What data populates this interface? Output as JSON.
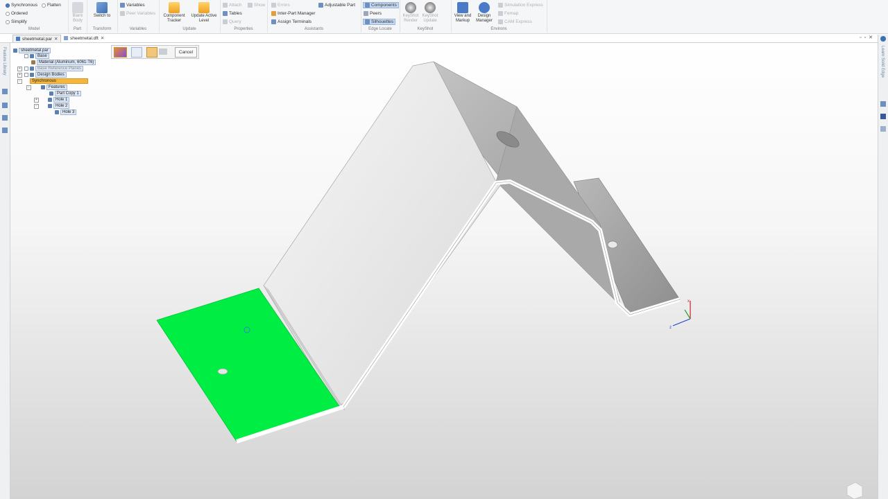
{
  "ribbon": {
    "model": {
      "label": "Model",
      "options": [
        {
          "label": "Synchronous",
          "selected": true
        },
        {
          "label": "Ordered",
          "selected": false
        },
        {
          "label": "Simplify",
          "selected": false
        }
      ],
      "flatten": "Flatten"
    },
    "blank_body": {
      "label": "Blank Body",
      "group": "Part"
    },
    "switch": {
      "label": "Switch to",
      "label2": "Transform"
    },
    "variables": {
      "label": "Variables",
      "peer_vars": "Peer Variables",
      "group": "Variables"
    },
    "update": {
      "component_tracker": "Component Tracker",
      "update_active_level": "Update Active Level",
      "group": "Update"
    },
    "properties": {
      "items": [
        "Attach",
        "Show",
        "Tables",
        "Query"
      ],
      "group": "Properties"
    },
    "assistants": {
      "items": [
        "Errors",
        "Inter-Part Manager",
        "Assign Terminals"
      ],
      "adjustable": "Adjustable Part",
      "group": "Assistants"
    },
    "edge_locate": {
      "items": [
        "Components",
        "Peers",
        "Silhouettes"
      ],
      "group": "Edge Locate"
    },
    "keyshot": {
      "render": "KeyShot Render",
      "update": "KeyShot Update",
      "group": "KeyShot"
    },
    "environs": {
      "view_markup": "View and Markup",
      "design_manager": "Design Manager",
      "items": [
        "Simulation Express",
        "Femap",
        "CAM Express"
      ],
      "group": "Environs"
    }
  },
  "tabs": [
    {
      "label": "sheetmetal.par",
      "active": true
    },
    {
      "label": "sheetmetal.dft",
      "active": false
    }
  ],
  "side": {
    "left": "Feature Library",
    "right": "Learn Solid Edge"
  },
  "tree": {
    "root": "sheetmetal.par",
    "base": "Base",
    "material": "Material (Aluminum, 6061-T6)",
    "ref_planes": "Base Reference Planes",
    "design_bodies": "Design Bodies",
    "synchronous": "Synchronous",
    "features": "Features",
    "items": [
      "Part Copy 1",
      "Hole 1",
      "Hole 2",
      "Hole 3"
    ]
  },
  "command_bar": {
    "cancel": "Cancel"
  },
  "colors": {
    "selected_face": "#00ee44",
    "accent": "#f5b63c",
    "ribbon_bg": "#f5f6f7"
  },
  "icons": [
    "synchronous-icon",
    "view-markup-icon",
    "design-manager-icon",
    "keyshot-icon",
    "triad-icon",
    "view-cube-icon"
  ]
}
